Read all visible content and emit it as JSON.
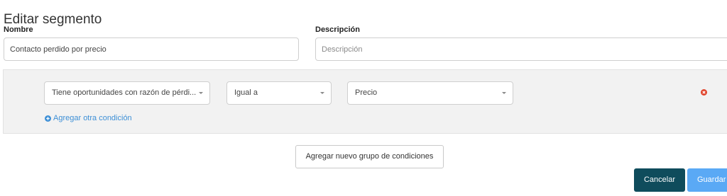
{
  "page": {
    "title": "Editar segmento"
  },
  "form": {
    "name_label": "Nombre",
    "name_value": "Contacto perdido por precio",
    "description_label": "Descripción",
    "description_placeholder": "Descripción"
  },
  "condition_group": {
    "conditions": [
      {
        "field": "Tiene oportunidades con razón de pérdi...",
        "operator": "Igual a",
        "value": "Precio"
      }
    ],
    "add_condition_label": "Agregar otra condición"
  },
  "actions": {
    "add_group_label": "Agregar nuevo grupo de condiciones",
    "cancel_label": "Cancelar",
    "save_label": "Guardar"
  },
  "colors": {
    "cancel_bg": "#0f4c5c",
    "save_bg": "#5aa9f5",
    "link": "#3d8fd6",
    "remove_icon": "#e0432b"
  }
}
